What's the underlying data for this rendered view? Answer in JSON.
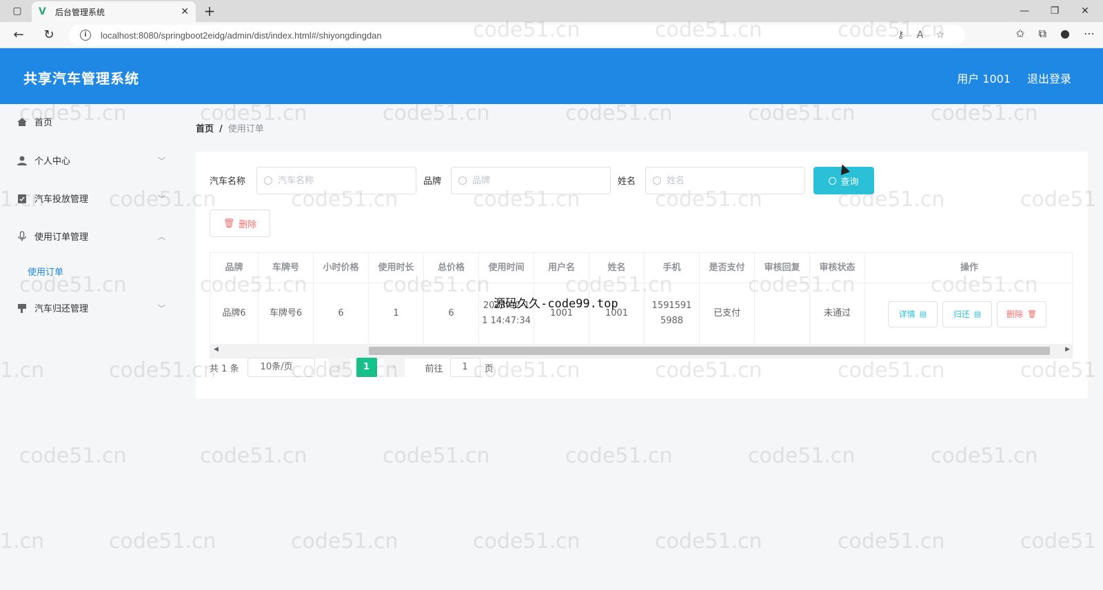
{
  "browser": {
    "tab_title": "后台管理系统",
    "url": "localhost:8080/springboot2eidg/admin/dist/index.html#/shiyongdingdan"
  },
  "header": {
    "title": "共享汽车管理系统",
    "user": "用户 1001",
    "logout": "退出登录"
  },
  "sidebar": {
    "items": [
      {
        "label": "首页",
        "icon": "home-icon"
      },
      {
        "label": "个人中心",
        "icon": "user-icon"
      },
      {
        "label": "汽车投放管理",
        "icon": "clipboard-icon"
      },
      {
        "label": "使用订单管理",
        "icon": "microphone-icon"
      },
      {
        "label": "汽车归还管理",
        "icon": "flag-icon"
      }
    ],
    "sub_item": "使用订单"
  },
  "breadcrumb": {
    "home": "首页",
    "sep": "/",
    "current": "使用订单"
  },
  "filters": {
    "car_name_label": "汽车名称",
    "car_name_placeholder": "汽车名称",
    "brand_label": "品牌",
    "brand_placeholder": "品牌",
    "name_label": "姓名",
    "name_placeholder": "姓名",
    "search_button": "查询",
    "delete_button": "删除"
  },
  "table": {
    "headers": [
      "品牌",
      "车牌号",
      "小时价格",
      "使用时长",
      "总价格",
      "使用时间",
      "用户名",
      "姓名",
      "手机",
      "是否支付",
      "审核回复",
      "审核状态",
      "操作"
    ],
    "row": [
      "品牌6",
      "车牌号6",
      "6",
      "1",
      "6",
      "2023-02-11 14:47:34",
      "1001",
      "1001",
      "15915915988",
      "已支付",
      "",
      "未通过"
    ],
    "actions": {
      "detail": "详情",
      "return": "归还",
      "delete": "删除"
    }
  },
  "pagination": {
    "total": "共 1 条",
    "page_size": "10条/页",
    "current_page": "1",
    "goto_label": "前往",
    "goto_value": "1",
    "page_suffix": "页"
  },
  "watermarks": {
    "site": "code51.cn",
    "partial_left": "1.cn",
    "partial_right": "code51",
    "center": "源码久久-code99.top"
  },
  "colors": {
    "header": "#1f88e5",
    "search_button": "#2ac0d8",
    "pager_active": "#13c38a",
    "danger": "#f56c6c",
    "link": "#1f88e5"
  }
}
